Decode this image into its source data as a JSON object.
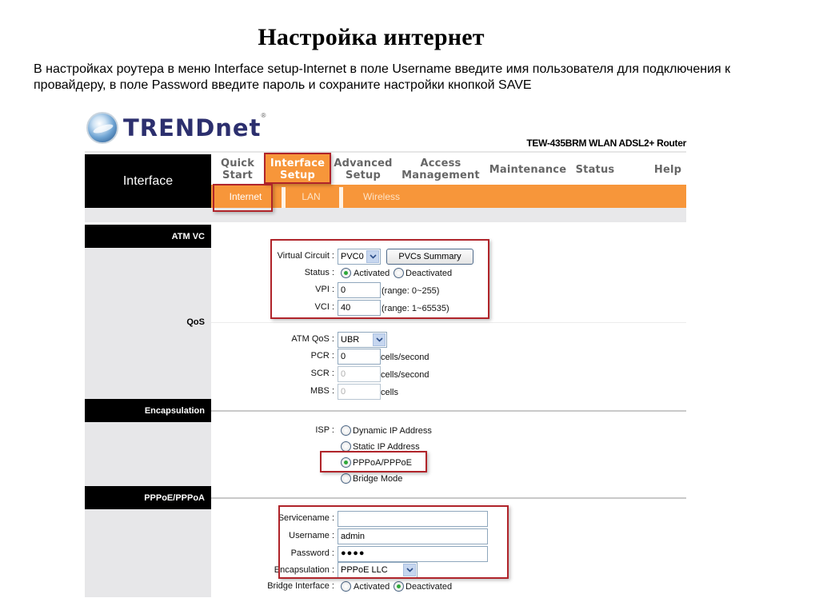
{
  "slide": {
    "title": "Настройка интернет",
    "description": "В настройках роутера в меню Interface setup-Internet  в поле Username введите имя пользователя для подключения к  провайдеру, в поле Password  введите пароль и сохраните настройки кнопкой SAVE"
  },
  "router": {
    "brand": "TRENDnet",
    "brand_reg": "®",
    "model": "TEW-435BRM WLAN ADSL2+ Router",
    "section_title": "Interface",
    "accent_color": "#f7963a",
    "highlight_color": "#b0242a",
    "nav": [
      {
        "label": "Quick\nStart",
        "active": false
      },
      {
        "label": "Interface\nSetup",
        "active": true
      },
      {
        "label": "Advanced\nSetup",
        "active": false
      },
      {
        "label": "Access\nManagement",
        "active": false
      },
      {
        "label": "Maintenance",
        "active": false
      },
      {
        "label": "Status",
        "active": false
      },
      {
        "label": "Help",
        "active": false
      }
    ],
    "subnav": [
      {
        "label": "Internet",
        "active": true
      },
      {
        "label": "LAN",
        "active": false
      },
      {
        "label": "Wireless",
        "active": false
      }
    ],
    "sidebar": {
      "atm_vc": "ATM VC",
      "qos": "QoS",
      "encapsulation": "Encapsulation",
      "pppoe": "PPPoE/PPPoA"
    },
    "atm_vc": {
      "virtual_circuit_label": "Virtual Circuit :",
      "virtual_circuit_value": "PVC0",
      "pvcs_summary_button": "PVCs Summary",
      "status_label": "Status :",
      "status_options": [
        "Activated",
        "Deactivated"
      ],
      "status_selected": "Activated",
      "vpi_label": "VPI :",
      "vpi_value": "0",
      "vpi_range": "(range: 0~255)",
      "vci_label": "VCI :",
      "vci_value": "40",
      "vci_range": "(range: 1~65535)"
    },
    "qos": {
      "atm_qos_label": "ATM QoS :",
      "atm_qos_value": "UBR",
      "pcr_label": "PCR :",
      "pcr_value": "0",
      "pcr_unit": "cells/second",
      "scr_label": "SCR :",
      "scr_value": "0",
      "scr_unit": "cells/second",
      "mbs_label": "MBS :",
      "mbs_value": "0",
      "mbs_unit": "cells"
    },
    "encapsulation": {
      "isp_label": "ISP :",
      "options": [
        "Dynamic IP Address",
        "Static IP Address",
        "PPPoA/PPPoE",
        "Bridge Mode"
      ],
      "selected": "PPPoA/PPPoE"
    },
    "pppoe": {
      "servicename_label": "Servicename :",
      "servicename_value": "",
      "username_label": "Username :",
      "username_value": "admin",
      "password_label": "Password :",
      "password_value": "●●●●",
      "encapsulation_label": "Encapsulation :",
      "encapsulation_value": "PPPoE LLC",
      "bridge_label": "Bridge Interface :",
      "bridge_options": [
        "Activated",
        "Deactivated"
      ],
      "bridge_selected": "Deactivated"
    }
  }
}
